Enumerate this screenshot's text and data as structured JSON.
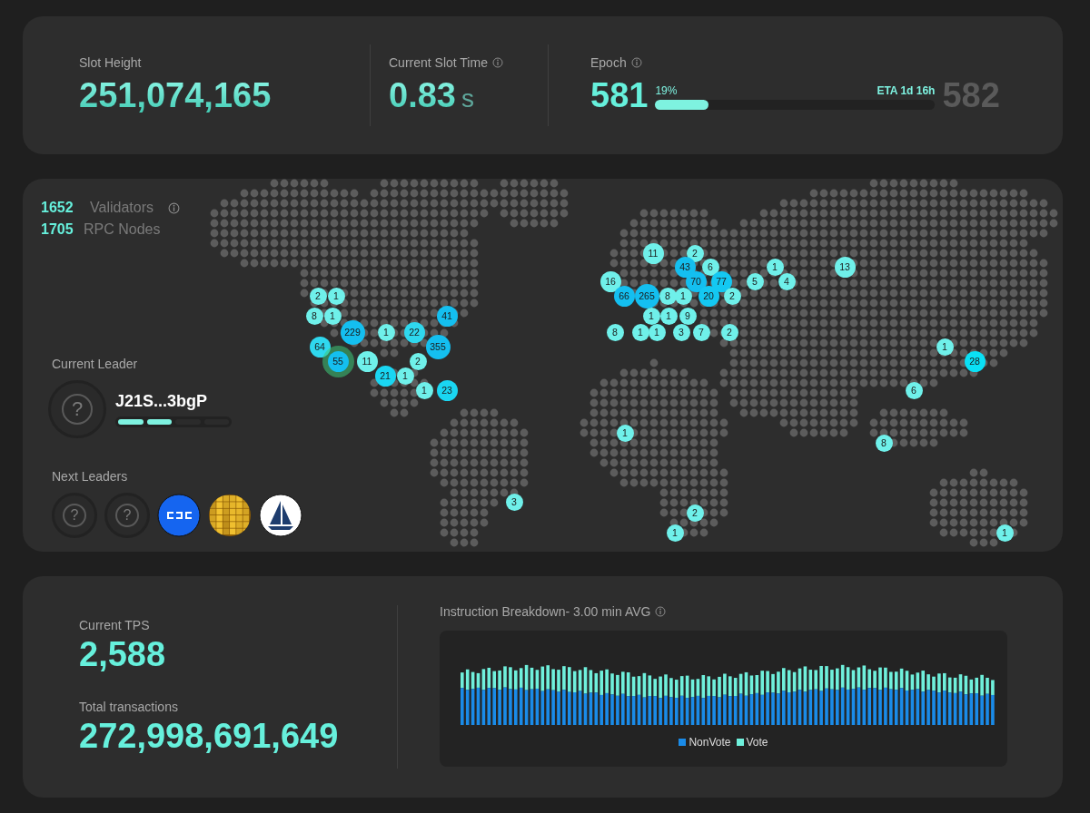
{
  "slot_height": {
    "label": "Slot Height",
    "value": "251,074,165"
  },
  "slot_time": {
    "label": "Current Slot Time",
    "value": "0.83",
    "unit": "s"
  },
  "epoch": {
    "label": "Epoch",
    "current": "581",
    "percent": "19%",
    "level": 0.19,
    "eta": "ETA 1d 16h",
    "next": "582"
  },
  "network": {
    "validators": {
      "count": "1652",
      "label": "Validators"
    },
    "rpc": {
      "count": "1705",
      "label": "RPC Nodes"
    }
  },
  "current_leader": {
    "label": "Current Leader",
    "symbol": "?",
    "name": "J21S...3bgP",
    "segments": [
      {
        "filled": true
      },
      {
        "filled": true
      },
      {
        "filled": false
      },
      {
        "filled": false
      }
    ]
  },
  "next_leaders": {
    "label": "Next Leaders",
    "items": [
      {
        "kind": "unknown",
        "symbol": "?"
      },
      {
        "kind": "unknown",
        "symbol": "?"
      },
      {
        "kind": "stripes"
      },
      {
        "kind": "mosaic"
      },
      {
        "kind": "sailboat"
      }
    ]
  },
  "map_markers": [
    {
      "label": "11",
      "color": "#6ff0ea",
      "current": false
    },
    {
      "label": "2",
      "color": "#6ff0ea",
      "current": false
    },
    {
      "label": "43",
      "color": "#14bff0",
      "current": false
    },
    {
      "label": "6",
      "color": "#6ff0ea",
      "current": false
    },
    {
      "label": "1",
      "color": "#6ff0ea",
      "current": false
    },
    {
      "label": "13",
      "color": "#6ff0ea",
      "current": false
    },
    {
      "label": "16",
      "color": "#6ff0ea",
      "current": false
    },
    {
      "label": "70",
      "color": "#14bff0",
      "current": false
    },
    {
      "label": "77",
      "color": "#14c8f2",
      "current": false
    },
    {
      "label": "5",
      "color": "#6ff0ea",
      "current": false
    },
    {
      "label": "4",
      "color": "#6ff0ea",
      "current": false
    },
    {
      "label": "2",
      "color": "#6ff0ea",
      "current": false
    },
    {
      "label": "1",
      "color": "#6ff0ea",
      "current": false
    },
    {
      "label": "66",
      "color": "#14bff0",
      "current": false
    },
    {
      "label": "265",
      "color": "#14bff0",
      "current": false
    },
    {
      "label": "8",
      "color": "#6ff0ea",
      "current": false
    },
    {
      "label": "1",
      "color": "#6ff0ea",
      "current": false
    },
    {
      "label": "20",
      "color": "#14c8f2",
      "current": false
    },
    {
      "label": "2",
      "color": "#6ff0ea",
      "current": false
    },
    {
      "label": "8",
      "color": "#6ff0ea",
      "current": false
    },
    {
      "label": "1",
      "color": "#6ff0ea",
      "current": false
    },
    {
      "label": "41",
      "color": "#14bff0",
      "current": false
    },
    {
      "label": "1",
      "color": "#6ff0ea",
      "current": false
    },
    {
      "label": "1",
      "color": "#6ff0ea",
      "current": false
    },
    {
      "label": "9",
      "color": "#6ff0ea",
      "current": false
    },
    {
      "label": "229",
      "color": "#14bff0",
      "current": false
    },
    {
      "label": "1",
      "color": "#6ff0ea",
      "current": false
    },
    {
      "label": "22",
      "color": "#2fd8ee",
      "current": false
    },
    {
      "label": "8",
      "color": "#6ff0ea",
      "current": false
    },
    {
      "label": "1",
      "color": "#6ff0ea",
      "current": false
    },
    {
      "label": "1",
      "color": "#6ff0ea",
      "current": false
    },
    {
      "label": "3",
      "color": "#6ff0ea",
      "current": false
    },
    {
      "label": "7",
      "color": "#6ff0ea",
      "current": false
    },
    {
      "label": "2",
      "color": "#6ff0ea",
      "current": false
    },
    {
      "label": "64",
      "color": "#2fd8ee",
      "current": false
    },
    {
      "label": "355",
      "color": "#14bff0",
      "current": false
    },
    {
      "label": "1",
      "color": "#6ff0ea",
      "current": false
    },
    {
      "label": "55",
      "color": "#14bff0",
      "current": true
    },
    {
      "label": "11",
      "color": "#6ff0ea",
      "current": false
    },
    {
      "label": "2",
      "color": "#6ff0ea",
      "current": false
    },
    {
      "label": "28",
      "color": "#0ae0f5",
      "current": false
    },
    {
      "label": "21",
      "color": "#1ad6f2",
      "current": false
    },
    {
      "label": "1",
      "color": "#6ff0ea",
      "current": false
    },
    {
      "label": "1",
      "color": "#6ff0ea",
      "current": false
    },
    {
      "label": "23",
      "color": "#1ad6f2",
      "current": false
    },
    {
      "label": "6",
      "color": "#6ff0ea",
      "current": false
    },
    {
      "label": "1",
      "color": "#6ff0ea",
      "current": false
    },
    {
      "label": "8",
      "color": "#6ff0ea",
      "current": false
    },
    {
      "label": "3",
      "color": "#6ff0ea",
      "current": false
    },
    {
      "label": "2",
      "color": "#6ff0ea",
      "current": false
    },
    {
      "label": "1",
      "color": "#6ff0ea",
      "current": false
    },
    {
      "label": "1",
      "color": "#6ff0ea",
      "current": false
    }
  ],
  "tps": {
    "label": "Current TPS",
    "value": "2,588"
  },
  "total_transactions": {
    "label": "Total transactions",
    "value": "272,998,691,649"
  },
  "instruction_breakdown": {
    "title": "Instruction Breakdown- 3.00 min AVG",
    "legend": [
      {
        "name": "NonVote",
        "color": "#1a8be8"
      },
      {
        "name": "Vote",
        "color": "#6ff0dc"
      }
    ]
  }
}
